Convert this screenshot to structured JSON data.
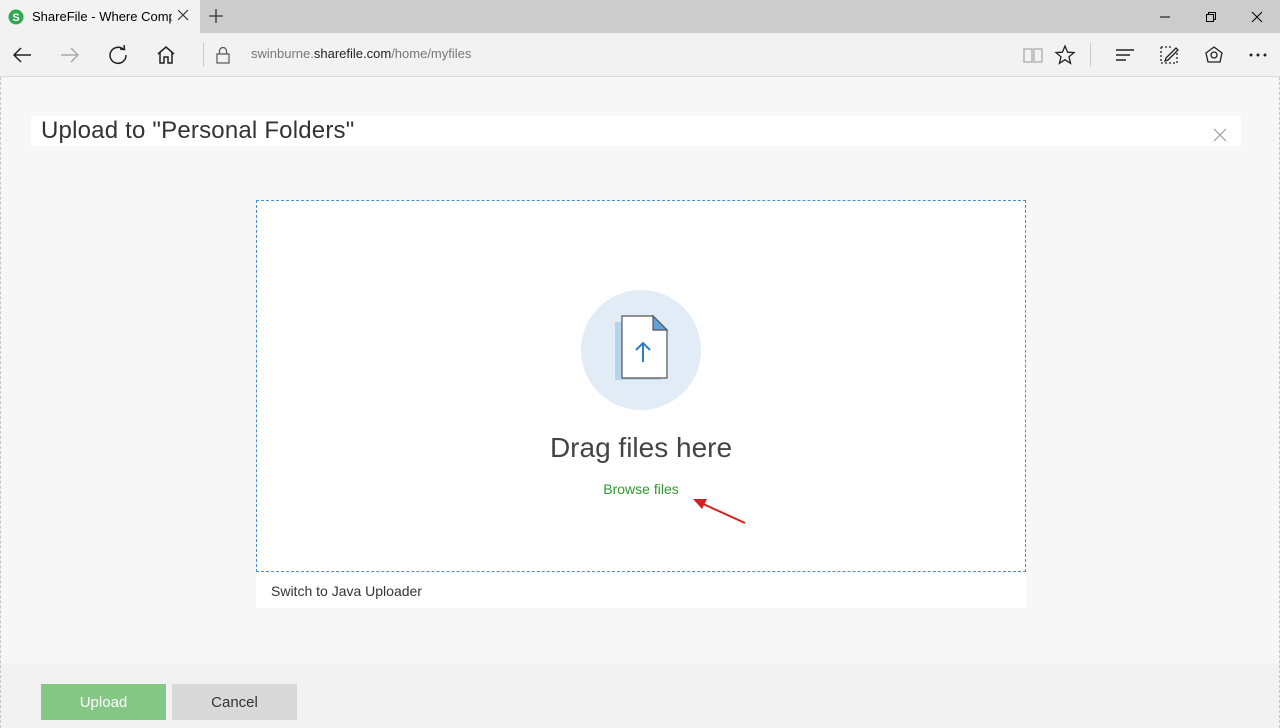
{
  "browser": {
    "tab_title": "ShareFile - Where Comp",
    "url_prefix": "swinburne.",
    "url_domain": "sharefile.com",
    "url_path": "/home/myfiles"
  },
  "dialog": {
    "title": "Upload to \"Personal Folders\"",
    "drag_text": "Drag files here",
    "browse_label": "Browse files",
    "java_label": "Switch to Java Uploader",
    "upload_label": "Upload",
    "cancel_label": "Cancel"
  },
  "colors": {
    "brand_green": "#2e9a2e",
    "upload_button": "#85c785",
    "dropzone_border": "#4a8fc8",
    "annotation_arrow": "#d42020"
  }
}
